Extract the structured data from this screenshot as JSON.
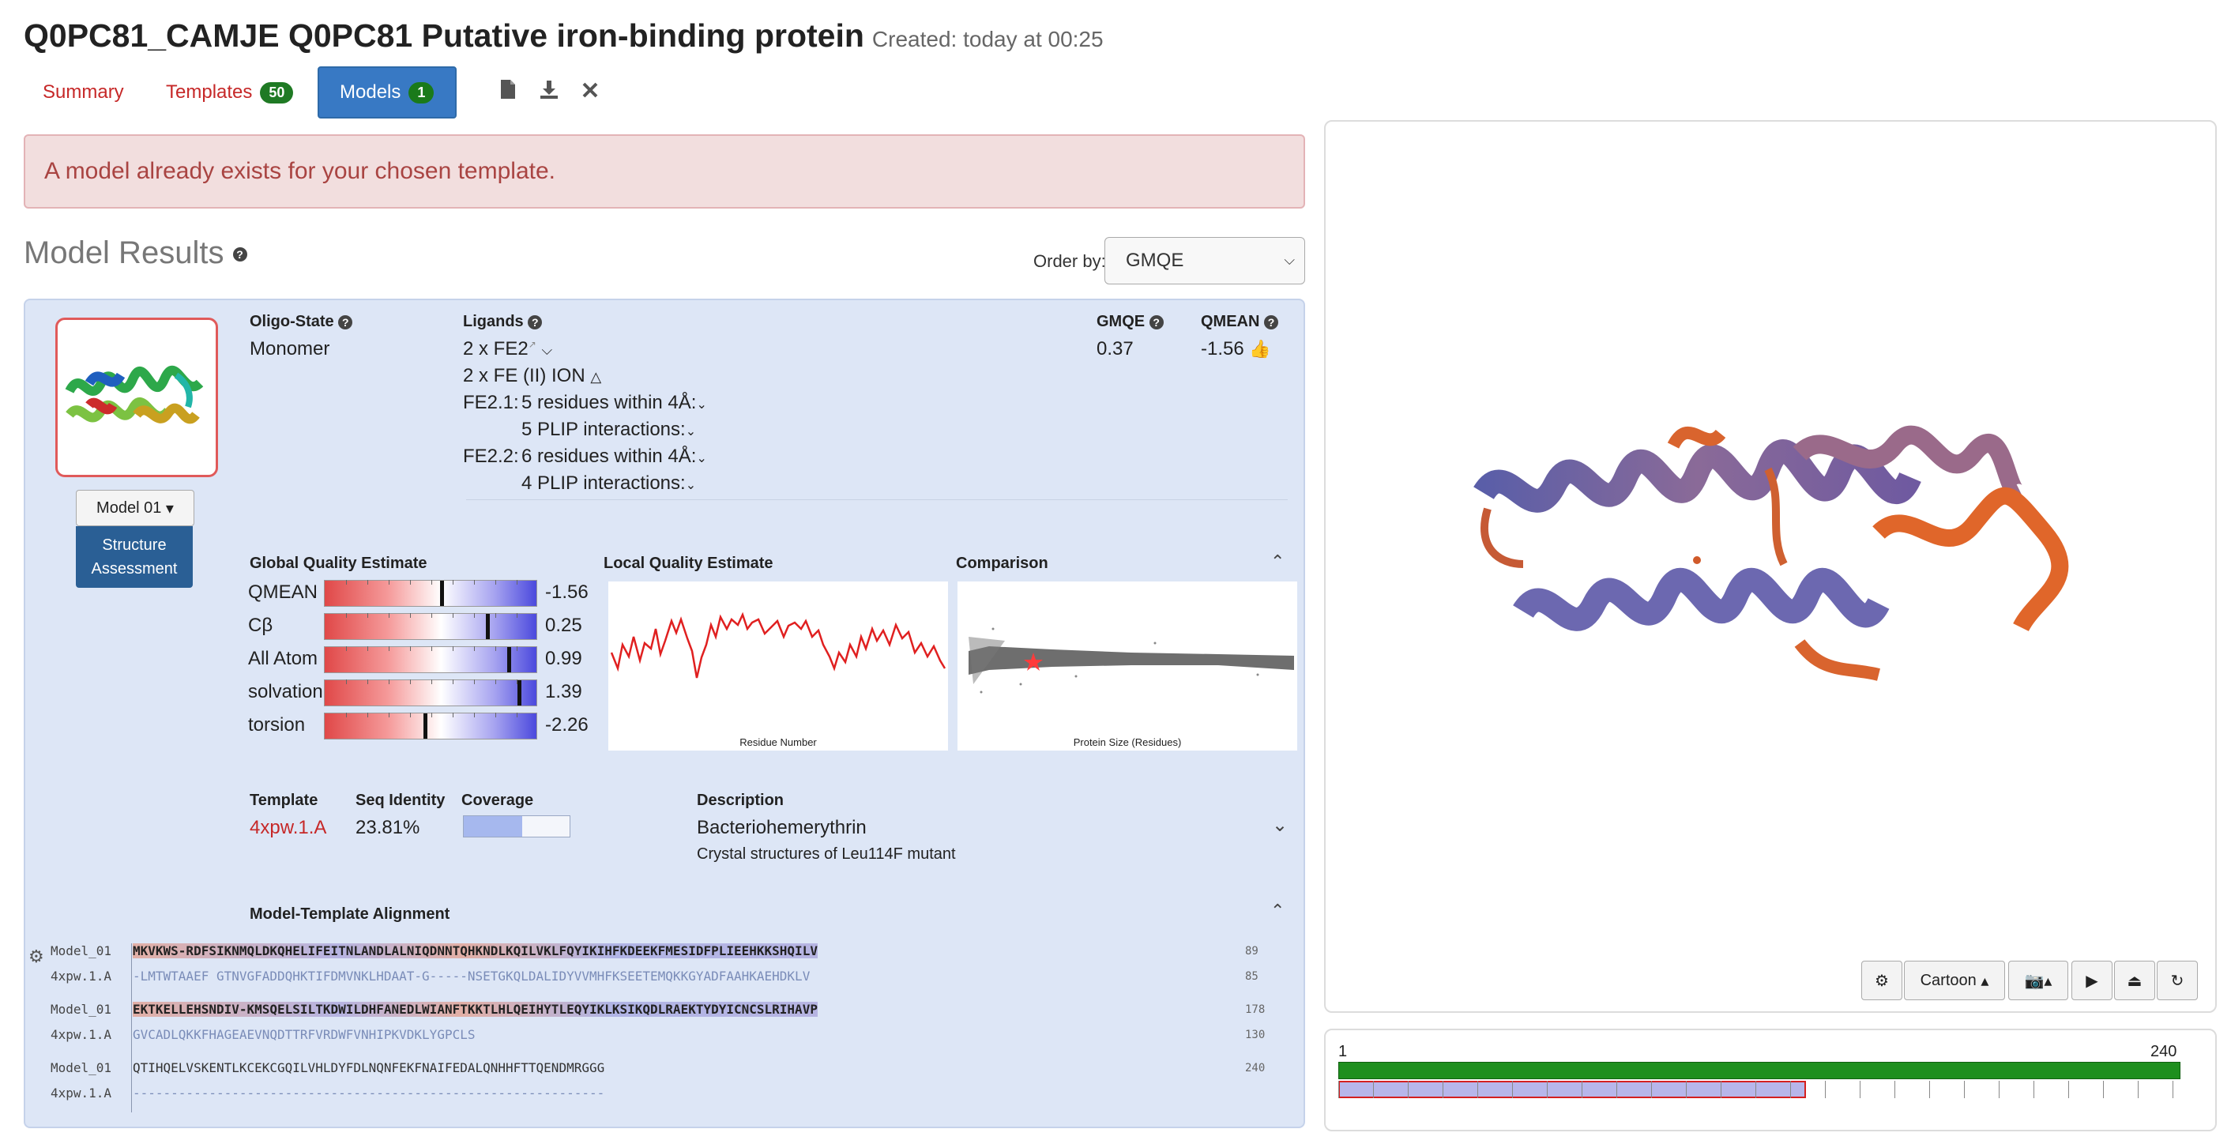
{
  "header": {
    "title": "Q0PC81_CAMJE Q0PC81 Putative iron-binding protein",
    "created": "Created: today at 00:25"
  },
  "tabs": [
    {
      "label": "Summary",
      "badge": null
    },
    {
      "label": "Templates",
      "badge": "50"
    },
    {
      "label": "Models",
      "badge": "1"
    }
  ],
  "alert": "A model already exists for your chosen template.",
  "model_results": {
    "heading": "Model Results",
    "order_by_label": "Order by:",
    "order_by_value": "GMQE"
  },
  "model": {
    "selector": "Model 01",
    "structure_button": "Structure Assessment",
    "oligo_label": "Oligo-State",
    "oligo_value": "Monomer",
    "ligands_label": "Ligands",
    "ligand_1": "2 x FE2",
    "ligand_2": "2 x FE (II) ION",
    "fe21_label": "FE2.1:",
    "fe21_residues": "5 residues within 4Å:",
    "fe21_plip": "5 PLIP interactions:",
    "fe22_label": "FE2.2:",
    "fe22_residues": "6 residues within 4Å:",
    "fe22_plip": "4 PLIP interactions:",
    "gmqe_label": "GMQE",
    "gmqe_value": "0.37",
    "qmean_label": "QMEAN",
    "qmean_value": "-1.56"
  },
  "global_quality": {
    "heading": "Global Quality Estimate",
    "rows": [
      {
        "name": "QMEAN",
        "value": "-1.56",
        "level": 0.55
      },
      {
        "name": "Cβ",
        "value": "0.25",
        "level": 0.77
      },
      {
        "name": "All Atom",
        "value": "0.99",
        "level": 0.87
      },
      {
        "name": "solvation",
        "value": "1.39",
        "level": 0.92
      },
      {
        "name": "torsion",
        "value": "-2.26",
        "level": 0.47
      }
    ]
  },
  "local_quality": {
    "heading": "Local Quality Estimate",
    "xlabel": "Residue Number"
  },
  "comparison": {
    "heading": "Comparison",
    "xlabel": "Protein Size (Residues)"
  },
  "template": {
    "template_label": "Template",
    "template_value": "4xpw.1.A",
    "identity_label": "Seq Identity",
    "identity_value": "23.81%",
    "coverage_label": "Coverage",
    "coverage_fraction": 0.55,
    "description_label": "Description",
    "description_value": "Bacteriohemerythrin",
    "description_detail": "Crystal structures of Leu114F mutant"
  },
  "alignment": {
    "heading": "Model-Template Alignment",
    "blocks": [
      {
        "model_name": "Model_01",
        "model_seq": "MKVKWS-RDFSIKNMQLDKQHELIFEITNLANDLALNIQDNNTQHKNDLKQILVKLFQYIKIHFKDEEKFMESIDFPLIEEHKKSHQILV",
        "model_num": "89",
        "template_name": "4xpw.1.A",
        "template_seq": "-LMTWTAAEF GTNVGFADDQHKTIFDMVNKLHDAAT-G-----NSETGKQLDALIDYVVMHFKSEETEMQKKGYADFAAHKAEHDKLV",
        "template_num": "85"
      },
      {
        "model_name": "Model_01",
        "model_seq": "EKTKELLEHSNDIV-KMSQELSILTKDWILDHFANEDLWIANFTKKTLHLQEIHYTLEQYIKLKSIKQDLRAEKTYDYICNCSLRIHAVP",
        "model_num": "178",
        "template_name": "4xpw.1.A",
        "template_seq": "GVCADLQKKFHAGEAEVNQDTTRFVRDWFVNHIPKVDKLYGPCLS",
        "template_num": "130"
      },
      {
        "model_name": "Model_01",
        "model_seq": "QTIHQELVSKENTLKCEKCGQILVHLDYFDLNQNFEKFNAIFEDALQNHHFTTQENDMRGGG",
        "model_num": "240",
        "template_name": "4xpw.1.A",
        "template_seq": "--------------------------------------------------------------",
        "template_num": ""
      }
    ]
  },
  "viewer": {
    "representation": "Cartoon"
  },
  "coverage_track": {
    "start": "1",
    "end": "240"
  }
}
